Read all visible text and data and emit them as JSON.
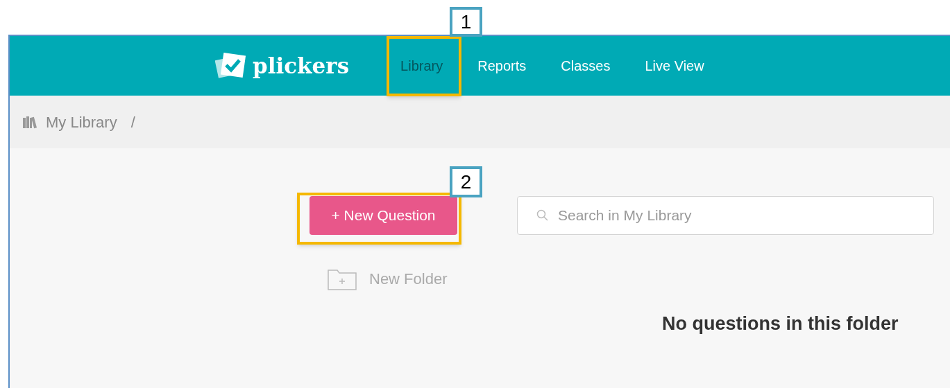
{
  "navbar": {
    "logo": "plickers",
    "items": [
      {
        "label": "Library",
        "selected": true
      },
      {
        "label": "Reports",
        "selected": false
      },
      {
        "label": "Classes",
        "selected": false
      },
      {
        "label": "Live View",
        "selected": false
      }
    ]
  },
  "breadcrumb": {
    "items": [
      "My Library"
    ],
    "separator": "/"
  },
  "toolbar": {
    "new_question": "+ New Question",
    "search": {
      "placeholder": "Search in My Library"
    },
    "new_folder": "New Folder"
  },
  "empty_message": "No questions in this folder",
  "callouts": [
    "1",
    "2"
  ]
}
